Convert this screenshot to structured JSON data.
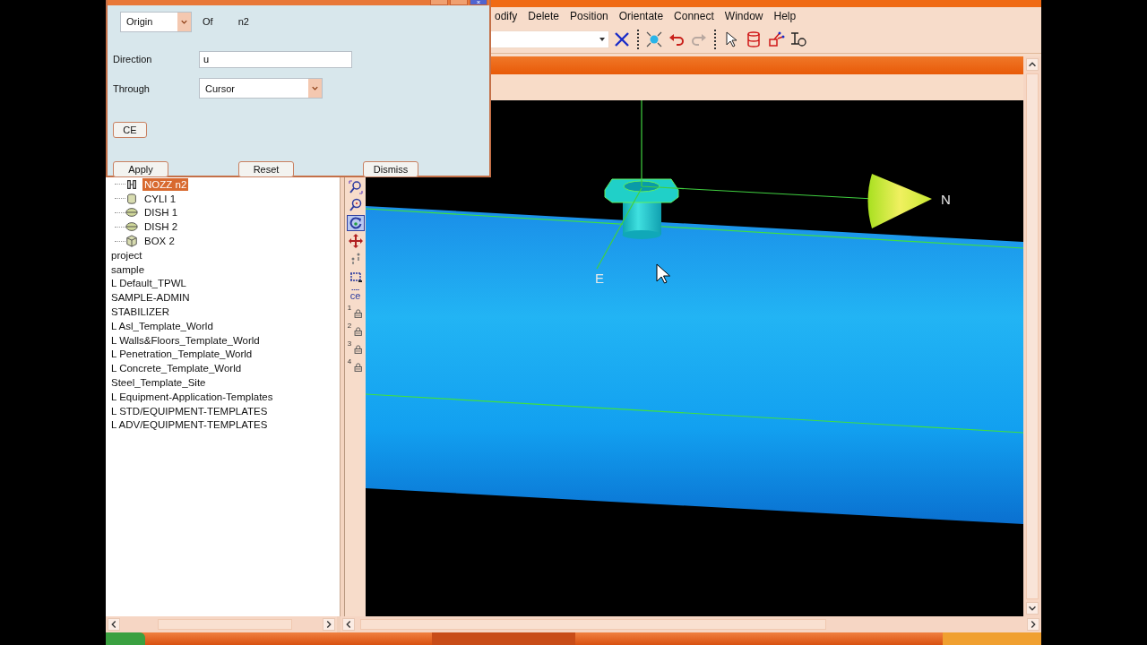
{
  "dialog": {
    "origin_select": {
      "value": "Origin"
    },
    "of_label": "Of",
    "element_name": "n2",
    "direction": {
      "label": "Direction",
      "value": "u"
    },
    "through": {
      "label": "Through",
      "value": "Cursor"
    },
    "ce_button": "CE",
    "buttons": [
      "Apply",
      "Reset",
      "Dismiss"
    ]
  },
  "menu": [
    "odify",
    "Delete",
    "Position",
    "Orientate",
    "Connect",
    "Window",
    "Help"
  ],
  "tree": {
    "branch_items": [
      {
        "label": "NOZZ n2",
        "kind": "nozzle",
        "selected": true
      },
      {
        "label": "CYLI 1",
        "kind": "cylinder",
        "selected": false
      },
      {
        "label": "DISH 1",
        "kind": "dish",
        "selected": false
      },
      {
        "label": "DISH 2",
        "kind": "dish",
        "selected": false
      },
      {
        "label": "BOX 2",
        "kind": "box",
        "selected": false
      }
    ],
    "items": [
      {
        "label": "project",
        "selected": false
      },
      {
        "label": "sample",
        "selected": false
      },
      {
        "label": "L Default_TPWL",
        "selected": false
      },
      {
        "label": "SAMPLE-ADMIN",
        "selected": false
      },
      {
        "label": "STABILIZER",
        "selected": false
      },
      {
        "label": "L Asl_Template_World",
        "selected": false
      },
      {
        "label": "L Walls&Floors_Template_World",
        "selected": false
      },
      {
        "label": "L Penetration_Template_World",
        "selected": false
      },
      {
        "label": "L Concrete_Template_World",
        "selected": false
      },
      {
        "label": "Steel_Template_Site",
        "selected": false
      },
      {
        "label": "L Equipment-Application-Templates",
        "selected": false
      },
      {
        "label": "L STD/EQUIPMENT-TEMPLATES",
        "selected": false
      },
      {
        "label": "L ADV/EQUIPMENT-TEMPLATES",
        "selected": false
      }
    ]
  },
  "view_tools": [
    {
      "kind": "zoom-area",
      "selected": false
    },
    {
      "kind": "zoom",
      "selected": false
    },
    {
      "kind": "rotate",
      "selected": true
    },
    {
      "kind": "pan",
      "selected": false
    },
    {
      "kind": "walk",
      "selected": false
    },
    {
      "kind": "limits",
      "selected": false
    },
    {
      "kind": "limits-ce",
      "label": "ce",
      "selected": false
    },
    {
      "kind": "saved-view",
      "label": "1",
      "selected": false
    },
    {
      "kind": "saved-view",
      "label": "2",
      "selected": false
    },
    {
      "kind": "saved-view",
      "label": "3",
      "selected": false
    },
    {
      "kind": "saved-view",
      "label": "4",
      "selected": false
    }
  ],
  "viewport": {
    "axis_labels": [
      "E",
      "N"
    ]
  }
}
